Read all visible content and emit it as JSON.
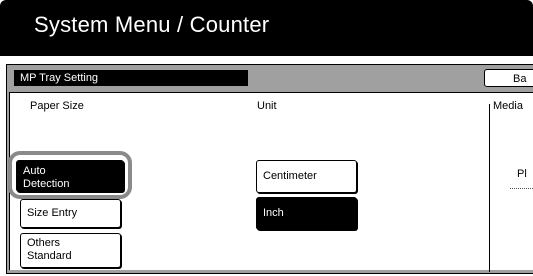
{
  "header": {
    "title": "System Menu / Counter"
  },
  "section": {
    "title": "MP Tray Setting"
  },
  "back_button": {
    "label": "Ba"
  },
  "paper_size": {
    "label": "Paper Size",
    "options": {
      "auto_detection": "Auto\nDetection",
      "size_entry": "Size Entry",
      "others_standard": "Others\nStandard"
    },
    "selected": "Auto Detection"
  },
  "unit": {
    "label": "Unit",
    "options": {
      "centimeter": "Centimeter",
      "inch": "Inch"
    },
    "selected": "Inch"
  },
  "media": {
    "label": "Media",
    "value": "Pl"
  },
  "colors": {
    "header_bg": "#000000",
    "selected_bg": "#000000",
    "highlight_ring": "#8a8a8a"
  }
}
